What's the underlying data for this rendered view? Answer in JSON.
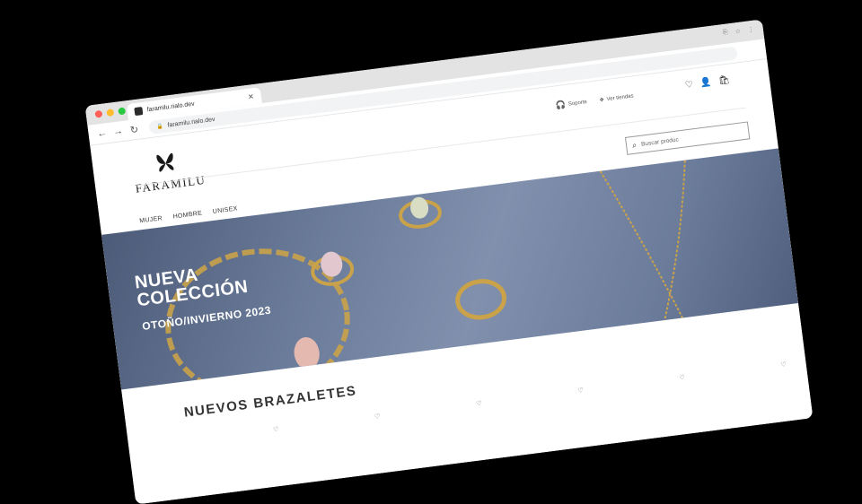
{
  "browser": {
    "tab_title": "faramilu.rialo.dev",
    "url": "faramilu.rialo.dev",
    "traffic_colors": [
      "#ff5f57",
      "#febc2e",
      "#28c840"
    ]
  },
  "site": {
    "brand": "FARAMILU",
    "utility": {
      "support": "Soporte",
      "stores": "Ver tiendas"
    },
    "nav": [
      "MUJER",
      "HOMBRE",
      "UNISEX"
    ],
    "search_placeholder": "Buscar produc",
    "hero": {
      "line1": "NUEVA",
      "line2": "COLECCIÓN",
      "subtitle": "OTOÑO/INVIERNO 2023"
    },
    "section_title": "NUEVOS BRAZALETES",
    "heart_glyph": "♡"
  }
}
